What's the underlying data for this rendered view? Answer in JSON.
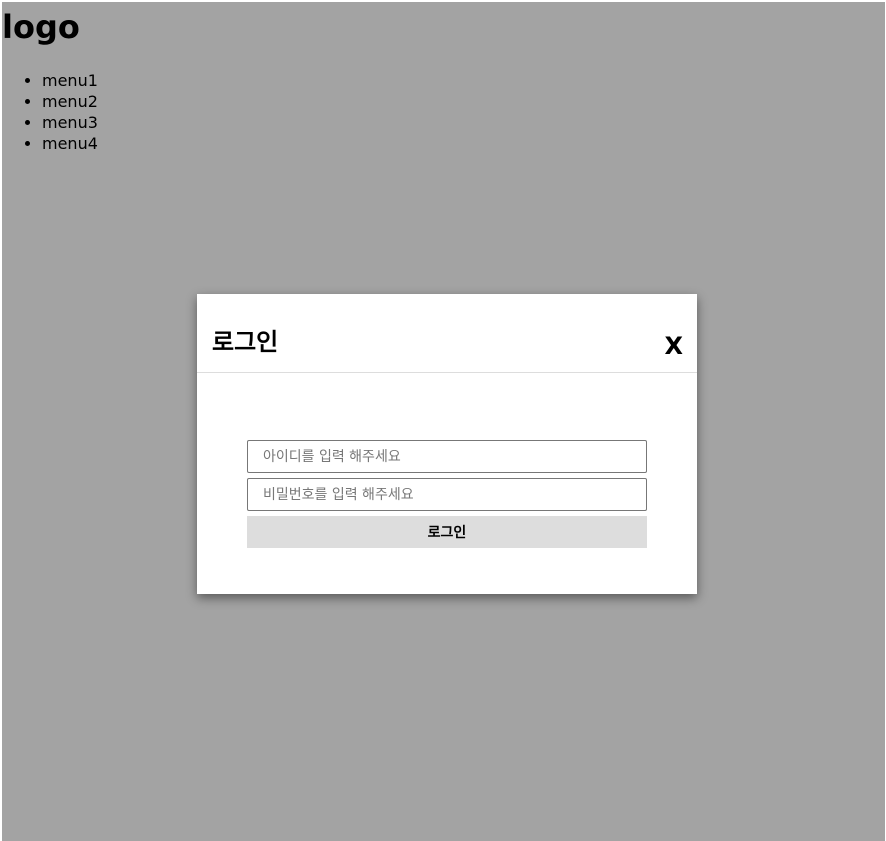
{
  "header": {
    "logo": "logo"
  },
  "nav": {
    "items": [
      {
        "label": "menu1"
      },
      {
        "label": "menu2"
      },
      {
        "label": "menu3"
      },
      {
        "label": "menu4"
      }
    ]
  },
  "modal": {
    "title": "로그인",
    "close_label": "X",
    "id_field": {
      "value": "",
      "placeholder": "아이디를 입력 해주세요"
    },
    "password_field": {
      "value": "",
      "placeholder": "비밀번호를 입력 해주세요"
    },
    "submit_label": "로그인"
  },
  "colors": {
    "overlay": "#a4a4a4",
    "modal_background": "#ffffff",
    "button_background": "#dddddd"
  }
}
